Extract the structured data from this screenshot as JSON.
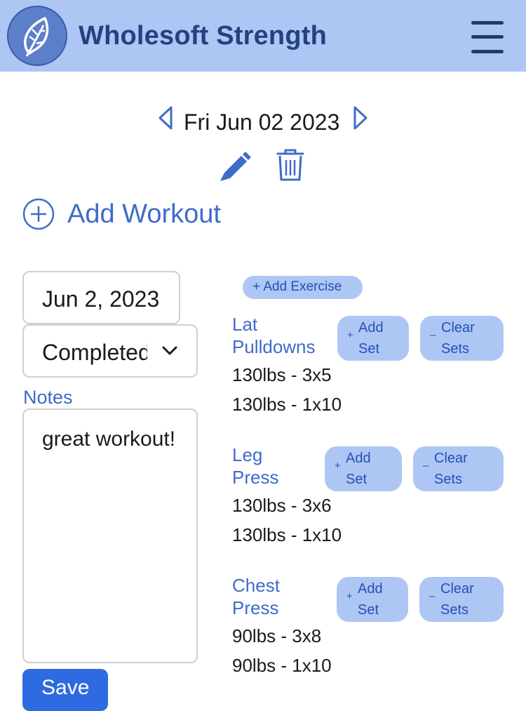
{
  "header": {
    "title": "Wholesoft Strength",
    "logo_icon": "leaf-icon",
    "menu_icon": "hamburger-menu-icon",
    "background": "#aec6f4",
    "title_color": "#24427f"
  },
  "date_nav": {
    "date": "Fri Jun 02 2023",
    "prev_icon": "chevron-left-icon",
    "next_icon": "chevron-right-icon",
    "edit_icon": "pencil-icon",
    "delete_icon": "trash-icon"
  },
  "add_workout": {
    "label": "Add Workout",
    "icon": "plus-circle-icon"
  },
  "workout": {
    "date_value": "Jun 2, 2023",
    "status_value": "Completed",
    "notes_label": "Notes",
    "notes_value": "great workout!",
    "save_label": "Save"
  },
  "add_exercise_label": "+ Add Exercise",
  "exercises": [
    {
      "name_line1": "Lat",
      "name_line2": "Pulldowns",
      "add_set_line1": "Add",
      "add_set_line2": "Set",
      "clear_sets_line1": "Clear",
      "clear_sets_line2": "Sets",
      "sets": [
        "130lbs - 3x5",
        "130lbs - 1x10"
      ]
    },
    {
      "name_line1": "Leg",
      "name_line2": "Press",
      "add_set_line1": "Add",
      "add_set_line2": "Set",
      "clear_sets_line1": "Clear",
      "clear_sets_line2": "Sets",
      "sets": [
        "130lbs - 3x6",
        "130lbs - 1x10"
      ]
    },
    {
      "name_line1": "Chest",
      "name_line2": "Press",
      "add_set_line1": "Add",
      "add_set_line2": "Set",
      "clear_sets_line1": "Clear",
      "clear_sets_line2": "Sets",
      "sets": [
        "90lbs - 3x8",
        "90lbs - 1x10"
      ]
    }
  ],
  "colors": {
    "accent": "#3f6cc9",
    "pill_background": "#aec6f4",
    "save_button": "#2f6be0"
  }
}
